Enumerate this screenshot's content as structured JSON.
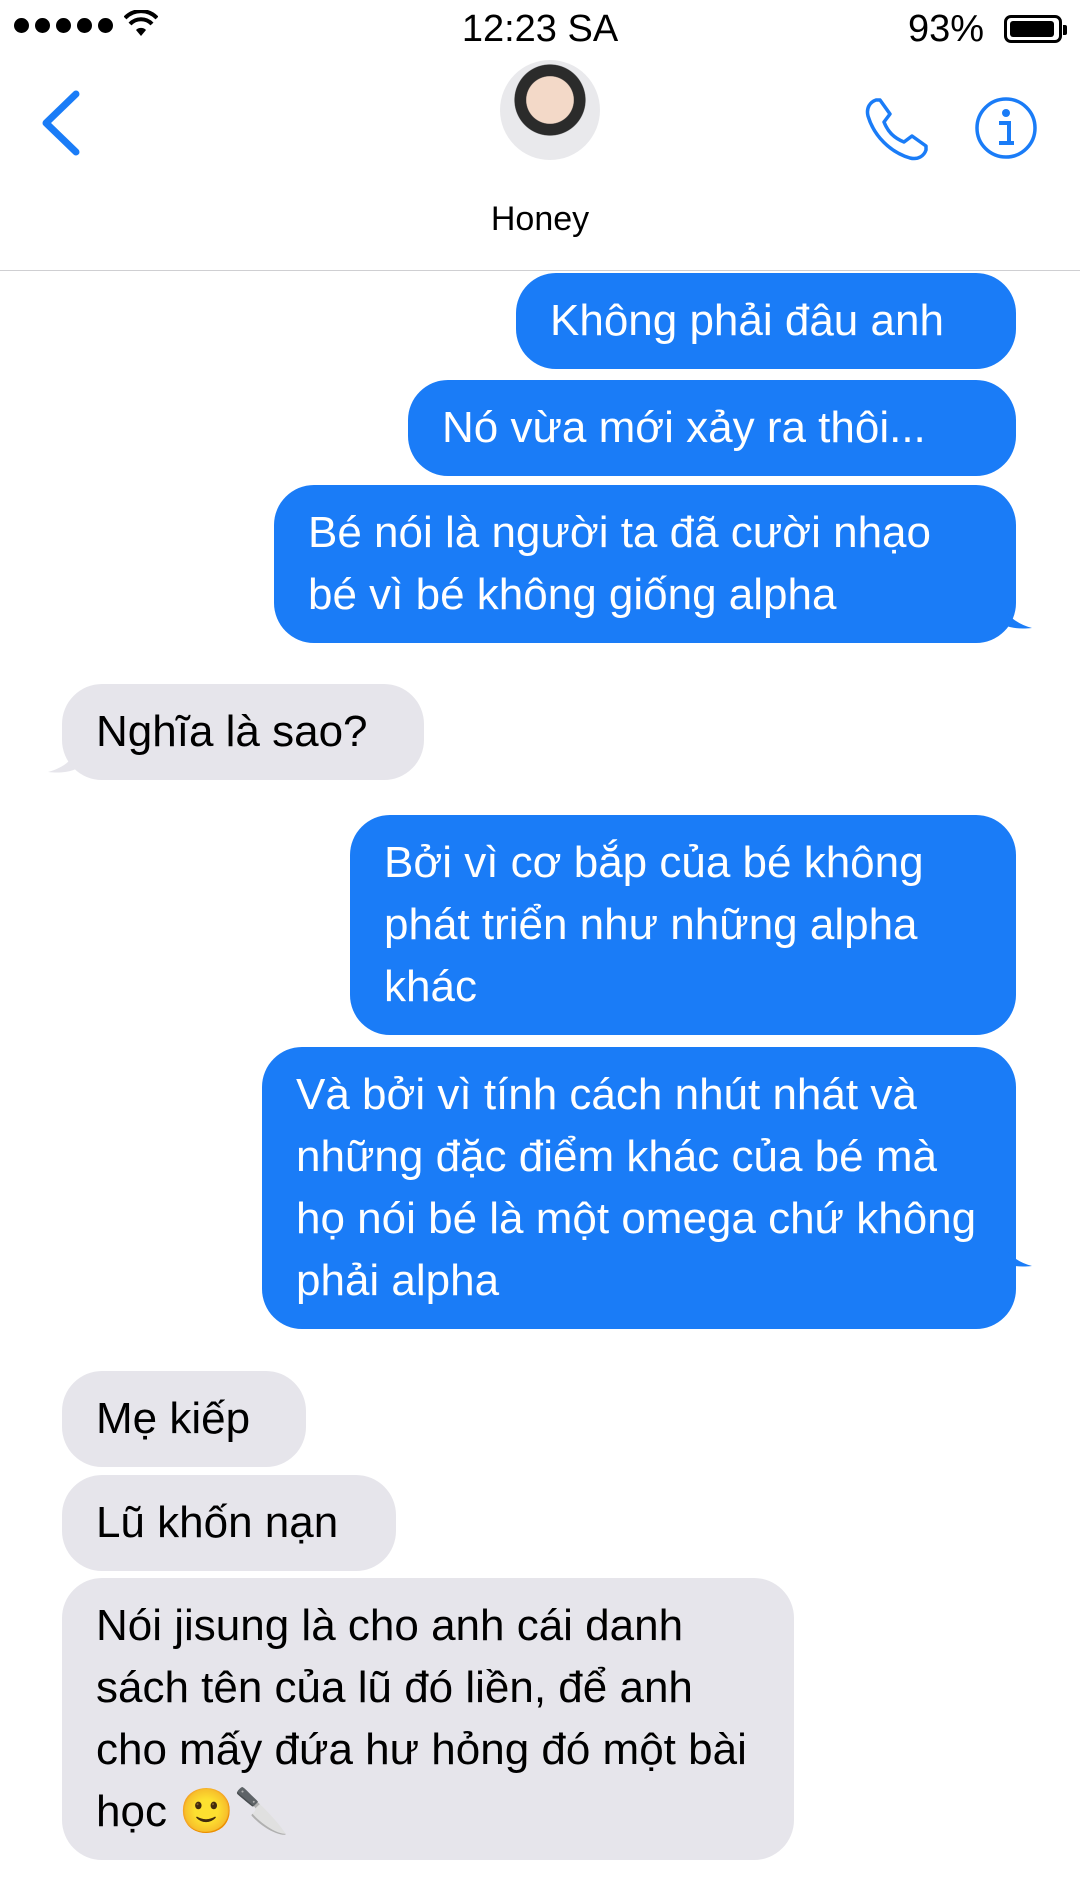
{
  "status": {
    "time": "12:23 SA",
    "battery": "93%"
  },
  "header": {
    "contact_name": "Honey"
  },
  "colors": {
    "accent": "#1a7cf7",
    "sent_bubble": "#1a7cf7",
    "received_bubble": "#e6e5eb"
  },
  "messages": [
    {
      "direction": "sent",
      "text": "Không phải đâu anh"
    },
    {
      "direction": "sent",
      "text": "Nó vừa mới xảy ra thôi..."
    },
    {
      "direction": "sent",
      "text": "Bé nói là người ta đã cười nhạo bé vì bé không giống alpha"
    },
    {
      "direction": "received",
      "text": "Nghĩa là sao?"
    },
    {
      "direction": "sent",
      "text": "Bởi vì cơ bắp của bé không phát triển như những alpha khác"
    },
    {
      "direction": "sent",
      "text": "Và bởi vì tính cách nhút nhát và những đặc điểm khác của bé mà họ nói bé là một omega chứ không phải alpha"
    },
    {
      "direction": "received",
      "text": "Mẹ kiếp"
    },
    {
      "direction": "received",
      "text": "Lũ khốn nạn"
    },
    {
      "direction": "received",
      "text": "Nói jisung là cho anh cái danh sách tên của lũ đó liền, để anh cho mấy đứa hư hỏng đó một bài học 🙂🔪"
    }
  ],
  "icons": {
    "back": "chevron-left-icon",
    "call": "phone-icon",
    "info": "info-icon"
  }
}
